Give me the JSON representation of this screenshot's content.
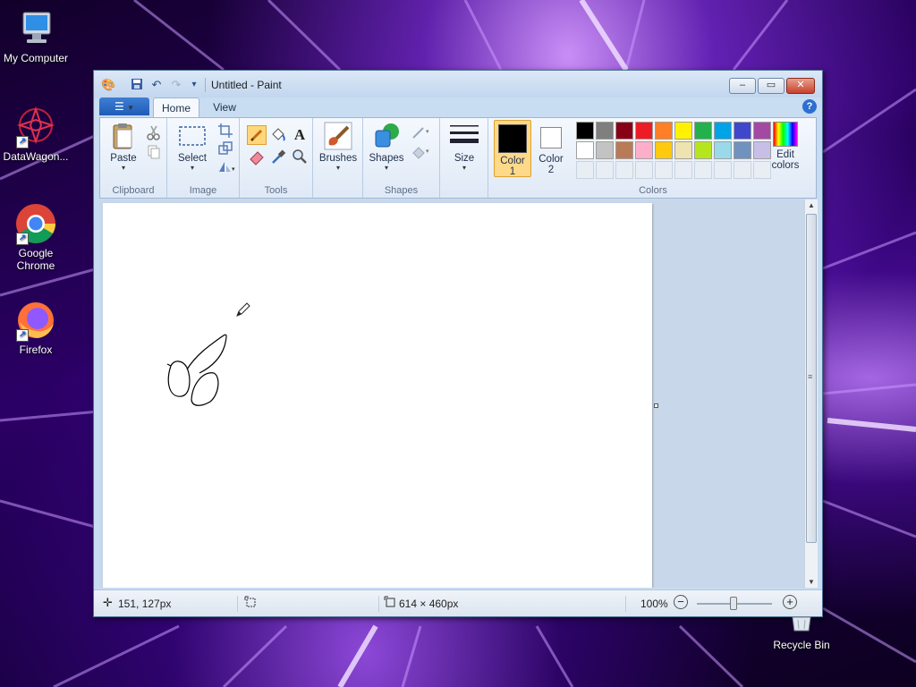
{
  "desktop": {
    "icons": [
      {
        "label": "My Computer"
      },
      {
        "label": "DataWagon..."
      },
      {
        "label": "Google Chrome"
      },
      {
        "label": "Firefox"
      },
      {
        "label": "Recycle Bin"
      }
    ]
  },
  "window": {
    "title": "Untitled - Paint",
    "buttons": {
      "minimize": "‒",
      "maximize": "▭",
      "close": "✕"
    }
  },
  "ribbon": {
    "tabs": [
      {
        "label": "Home",
        "active": true
      },
      {
        "label": "View",
        "active": false
      }
    ],
    "groups": {
      "clipboard": {
        "label": "Clipboard",
        "paste": "Paste"
      },
      "image": {
        "label": "Image",
        "select": "Select"
      },
      "tools": {
        "label": "Tools"
      },
      "brushes": {
        "label": "Brushes"
      },
      "shapes": {
        "label": "Shapes",
        "shapes_button": "Shapes"
      },
      "size": {
        "label": "Size"
      },
      "colors": {
        "label": "Colors",
        "color1_line1": "Color",
        "color1_line2": "1",
        "color2_line1": "Color",
        "color2_line2": "2",
        "edit_line1": "Edit",
        "edit_line2": "colors",
        "color1": "#000000",
        "color2": "#ffffff",
        "palette_row1": [
          "#000000",
          "#7f7f7f",
          "#880015",
          "#ed1c24",
          "#ff7f27",
          "#fff200",
          "#22b14c",
          "#00a2e8",
          "#3f48cc",
          "#a349a4"
        ],
        "palette_row2": [
          "#ffffff",
          "#c3c3c3",
          "#b97a57",
          "#ffaec9",
          "#ffc90e",
          "#efe4b0",
          "#b5e61d",
          "#99d9ea",
          "#7092be",
          "#c8bfe7"
        ]
      }
    }
  },
  "status": {
    "cursor_position": "151, 127px",
    "canvas_size": "614 × 460px",
    "zoom": "100%"
  }
}
